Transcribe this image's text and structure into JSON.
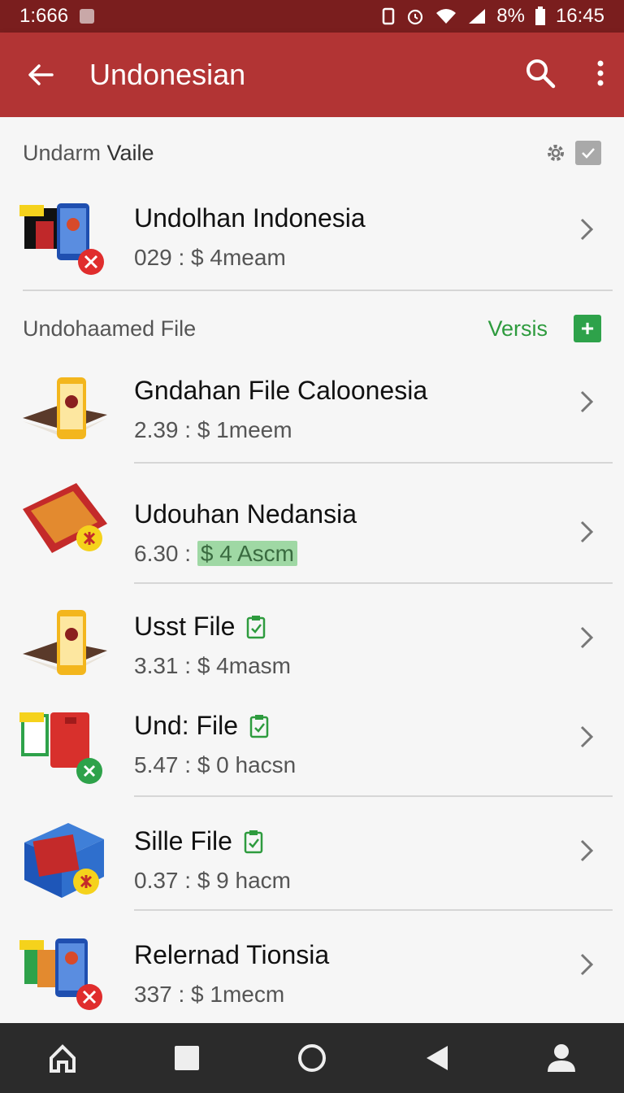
{
  "status": {
    "time_left": "1:666",
    "battery": "8%",
    "time_right": "16:45"
  },
  "appbar": {
    "title": "Undonesian"
  },
  "section1": {
    "prefix": "Undarm ",
    "bold": "Vaile"
  },
  "section2": {
    "label": "Undohaamed File",
    "action": "Versis",
    "plus": "+"
  },
  "rows": [
    {
      "title": "Undolhan Indonesia",
      "sub": "029 : $ 4meam"
    },
    {
      "title": "Gndahan File Caloonesia",
      "sub": "2.39 : $ 1meem"
    },
    {
      "title": "Udouhan Nedansia",
      "sub_prefix": "6.30 : ",
      "sub_highlight": "$ 4 Ascm"
    },
    {
      "title": "Usst File",
      "sub": "3.31 : $ 4masm"
    },
    {
      "title": "Und: File",
      "sub": "5.47 : $ 0 hacsn"
    },
    {
      "title": "Sille File",
      "sub": "0.37 : $ 9 hacm"
    },
    {
      "title": "Relernad Tionsia",
      "sub": "337 : $ 1mecm"
    }
  ],
  "colors": {
    "appbar": "#b23434",
    "statusbar": "#7a1e1e",
    "accent_green": "#2e9b3e",
    "navbar": "#2b2b2b"
  },
  "icons": [
    "back-arrow-icon",
    "search-icon",
    "more-vert-icon",
    "gear-icon",
    "checkbox-icon",
    "plus-icon",
    "chevron-right-icon",
    "clipboard-check-icon",
    "home-icon",
    "square-icon",
    "circle-icon",
    "triangle-back-icon",
    "person-icon"
  ]
}
